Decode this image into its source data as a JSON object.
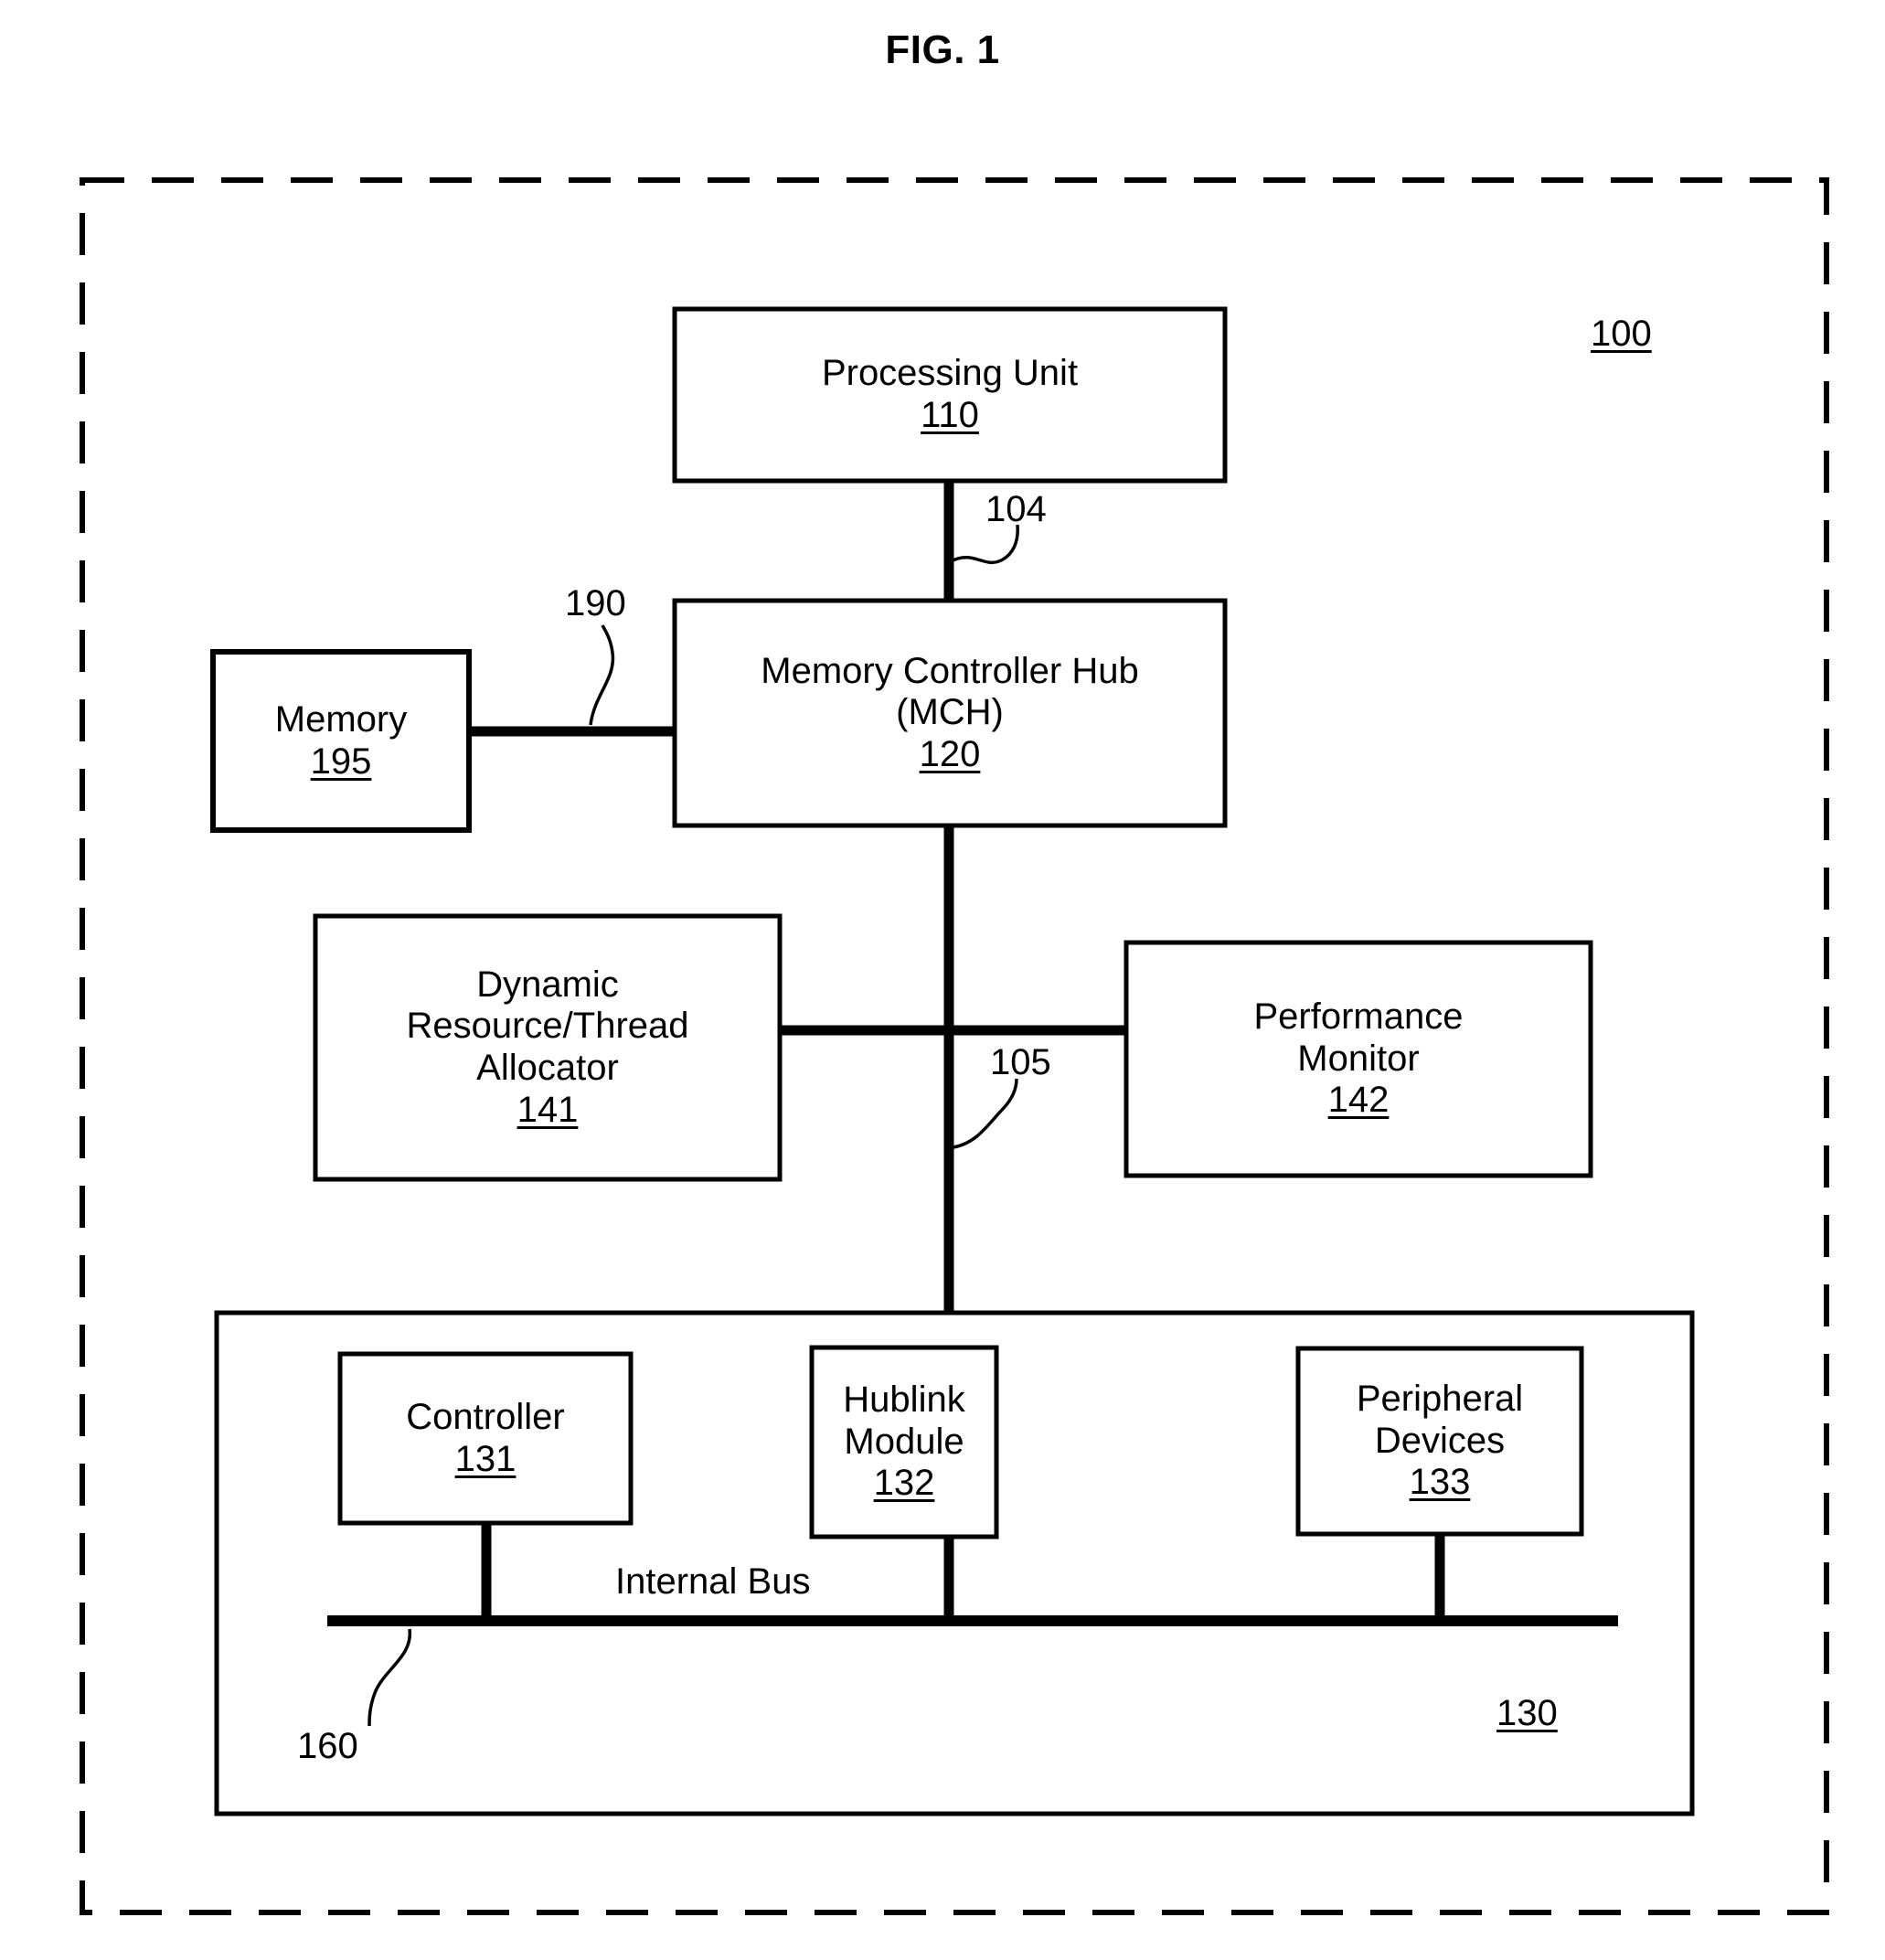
{
  "figure": {
    "title": "FIG. 1",
    "system_ref": "100"
  },
  "blocks": {
    "processing_unit": {
      "name": "Processing Unit",
      "ref": "110"
    },
    "mch": {
      "name": "Memory Controller Hub\n(MCH)",
      "ref": "120"
    },
    "memory": {
      "name": "Memory",
      "ref": "195"
    },
    "allocator": {
      "name": "Dynamic\nResource/Thread\nAllocator",
      "ref": "141"
    },
    "performance_monitor": {
      "name": "Performance\nMonitor",
      "ref": "142"
    },
    "controller": {
      "name": "Controller",
      "ref": "131"
    },
    "hublink_module": {
      "name": "Hublink\nModule",
      "ref": "132"
    },
    "peripheral_devices": {
      "name": "Peripheral\nDevices",
      "ref": "133"
    },
    "io_group": {
      "ref": "130"
    }
  },
  "connectors": {
    "pu_to_mch": "104",
    "mch_to_ich": "105",
    "memory_to_mch": "190",
    "internal_bus": {
      "label": "Internal Bus",
      "ref": "160"
    }
  },
  "colors": {
    "stroke": "#000000",
    "background": "#ffffff"
  }
}
